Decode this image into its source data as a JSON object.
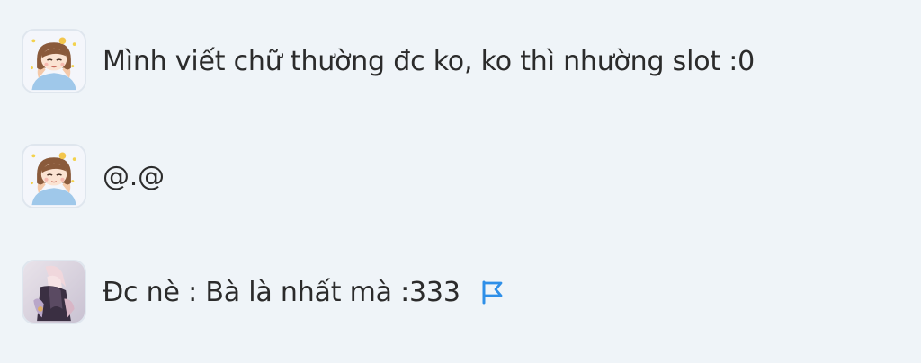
{
  "comments": [
    {
      "avatar": "girl-avatar",
      "text": "Mình viết chữ thường đc ko, ko thì nhường slot :0",
      "flag": false
    },
    {
      "avatar": "girl-avatar",
      "text": "@.@",
      "flag": false
    },
    {
      "avatar": "anime-art-avatar",
      "text": "Đc nè : Bà là nhất mà :333",
      "flag": true
    }
  ],
  "colors": {
    "background": "#eff4f8",
    "text": "#2b2b2b",
    "flag": "#2e8fe8"
  }
}
